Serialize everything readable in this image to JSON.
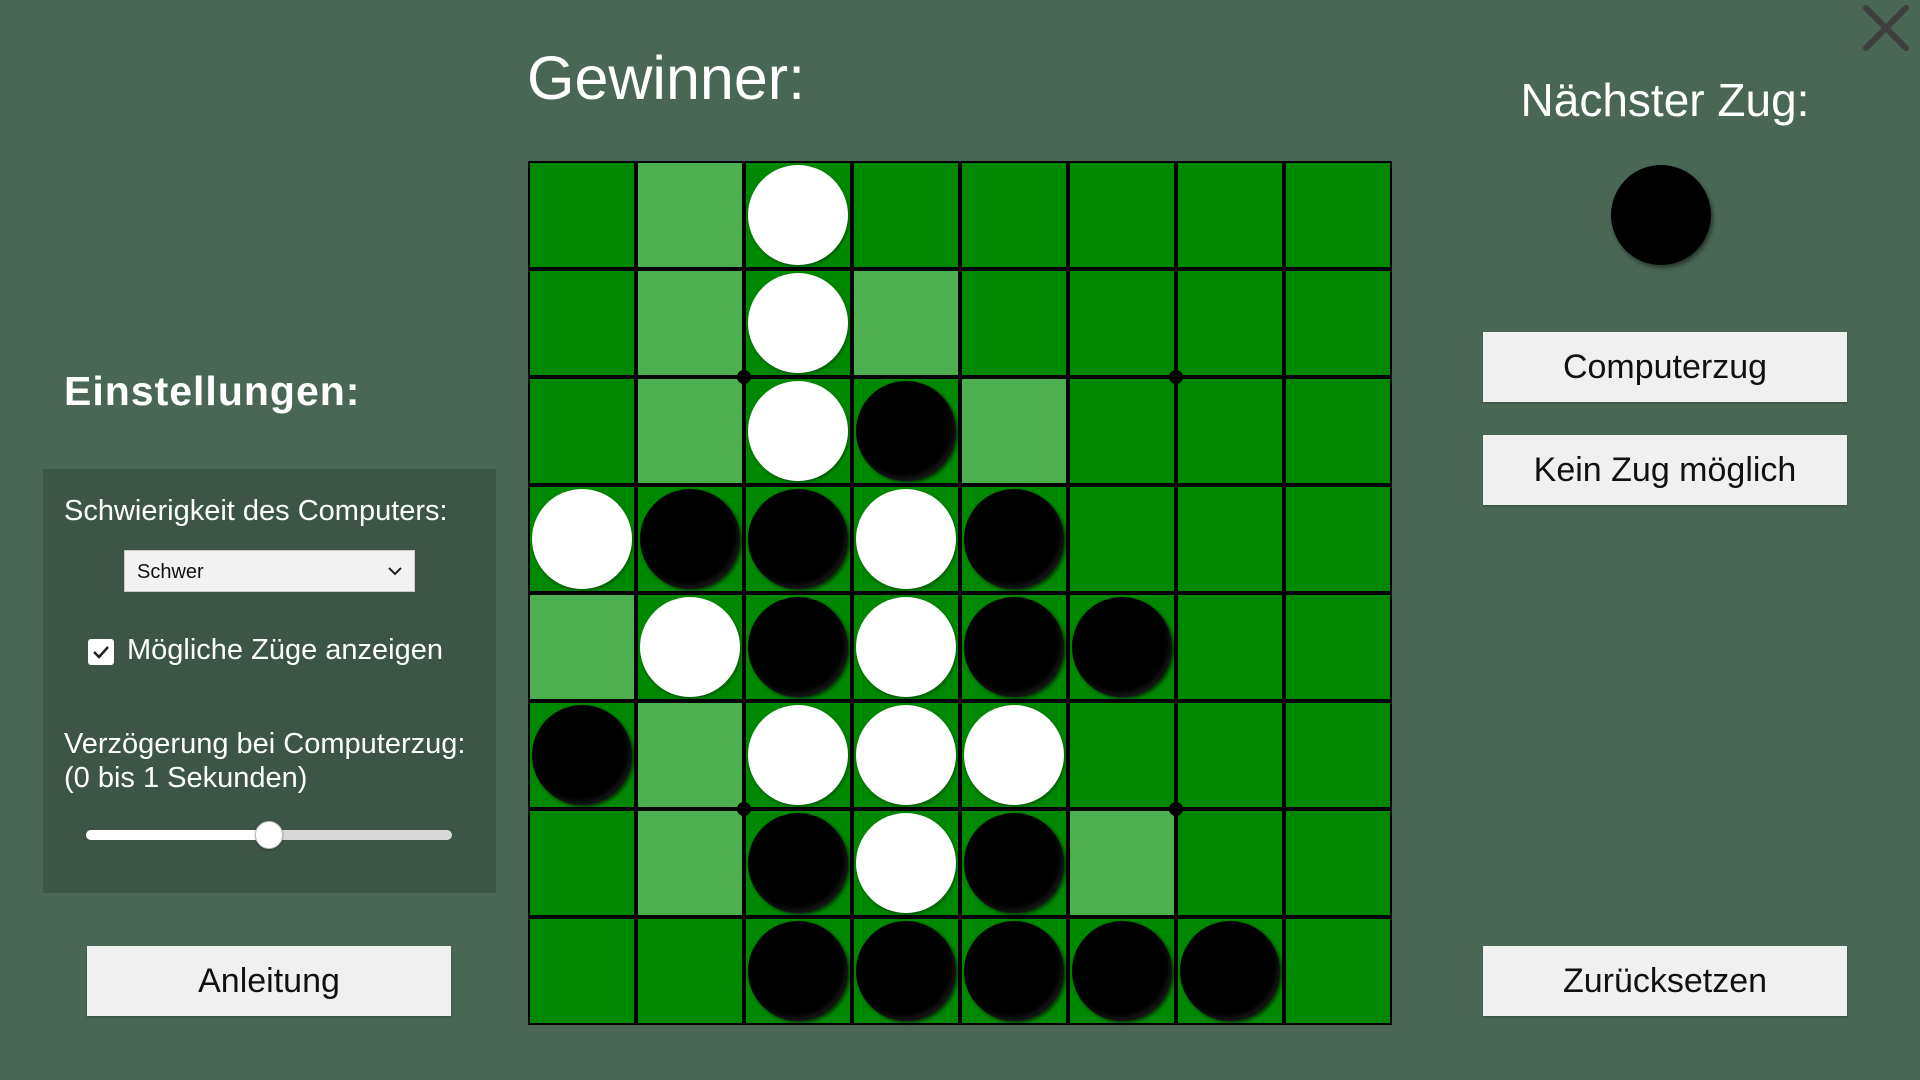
{
  "header": {
    "winner_label": "Gewinner:"
  },
  "window": {
    "close_icon": "close-icon"
  },
  "settings": {
    "title": "Einstellungen:",
    "difficulty_label": "Schwierigkeit des Computers:",
    "difficulty_value": "Schwer",
    "show_moves_label": "Mögliche Züge anzeigen",
    "show_moves_checked": true,
    "delay_label": "Verzögerung bei Computerzug:",
    "delay_range": "(0 bis 1 Sekunden)",
    "delay_value": 0.5
  },
  "buttons": {
    "instructions": "Anleitung",
    "computer_move": "Computerzug",
    "no_move": "Kein Zug möglich",
    "reset": "Zurücksetzen"
  },
  "next_move": {
    "label": "Nächster Zug:",
    "player": "black"
  },
  "board": {
    "legend": {
      "B": "black",
      "W": "white",
      "o": "possible move",
      ".": "empty"
    },
    "rows": [
      ".oW.....",
      ".oWo....",
      ".oWBo...",
      "WBBWB...",
      "oWBWBB..",
      "BoWWW...",
      ".oBWBo..",
      "..BBBBB."
    ],
    "colors": {
      "cell": "#008800",
      "hint": "#4caf50",
      "grid": "#000000"
    }
  }
}
